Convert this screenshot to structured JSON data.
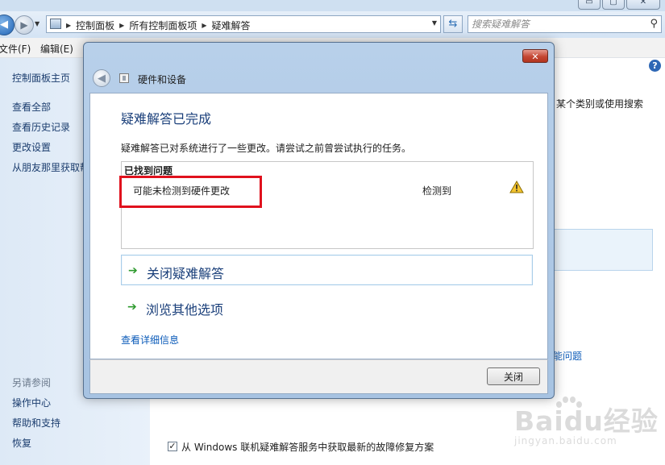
{
  "explorer": {
    "window_buttons": {
      "minimize": "▭",
      "maximize": "▢",
      "close": "✕"
    },
    "address": {
      "crumbs": [
        "控制面板",
        "所有控制面板项",
        "疑难解答"
      ]
    },
    "search": {
      "placeholder": "搜索疑难解答"
    },
    "menu": {
      "file": "文件(F)",
      "edit": "编辑(E)"
    },
    "left_pane": {
      "home": "控制面板主页",
      "links": [
        "查看全部",
        "查看历史记录",
        "更改设置",
        "从朋友那里获取帮助"
      ],
      "see_also_heading": "另请参阅",
      "see_also": [
        "操作中心",
        "帮助和支持",
        "恢复"
      ]
    },
    "main": {
      "partial_text": "某个类别或使用搜索",
      "partial_link": "能问题",
      "checkbox_label": "从 Windows 联机疑难解答服务中获取最新的故障修复方案",
      "checkbox_checked": true
    },
    "watermark": {
      "main": "Baidu经验",
      "sub": "jingyan.baidu.com"
    }
  },
  "dialog": {
    "title": "硬件和设备",
    "heading": "疑难解答已完成",
    "description": "疑难解答已对系统进行了一些更改。请尝试之前曾尝试执行的任务。",
    "problems": {
      "heading": "已找到问题",
      "items": [
        {
          "name": "可能未检测到硬件更改",
          "status": "检测到",
          "icon": "warning-icon"
        }
      ]
    },
    "actions": [
      "关闭疑难解答",
      "浏览其他选项"
    ],
    "details_link": "查看详细信息",
    "close_button": "关闭",
    "colors": {
      "heading": "#1a3f7a",
      "highlight": "#e0111d",
      "arrow": "#2e9a2e",
      "link": "#0b5bb9"
    }
  }
}
